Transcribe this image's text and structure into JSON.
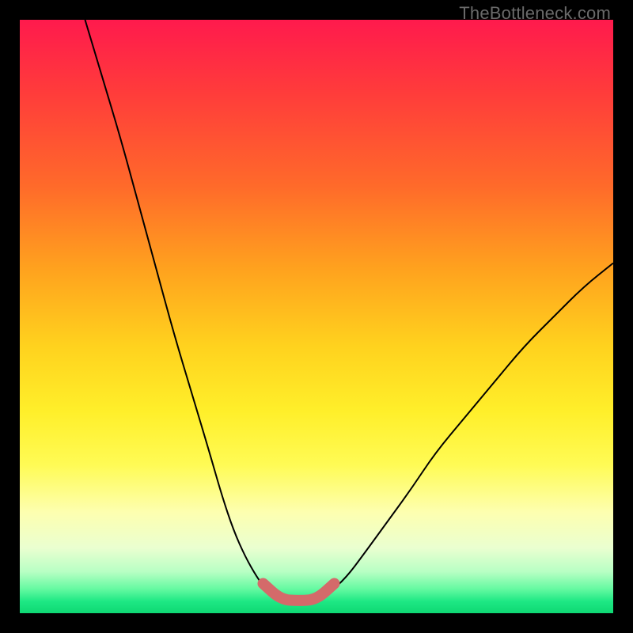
{
  "watermark": "TheBottleneck.com",
  "chart_data": {
    "type": "line",
    "title": "",
    "xlabel": "",
    "ylabel": "",
    "xlim": [
      0,
      100
    ],
    "ylim": [
      0,
      100
    ],
    "grid": false,
    "series": [
      {
        "name": "left-curve",
        "x": [
          11,
          14,
          17,
          20,
          23,
          26,
          29,
          32,
          34,
          36,
          38,
          40,
          41.5,
          43,
          44
        ],
        "y": [
          100,
          90,
          80,
          69,
          58,
          47,
          37,
          27,
          20,
          14,
          9.5,
          6,
          4,
          2.7,
          2.2
        ]
      },
      {
        "name": "right-curve",
        "x": [
          50,
          52,
          55,
          58,
          62,
          66,
          70,
          75,
          80,
          85,
          90,
          95,
          100
        ],
        "y": [
          2.2,
          3.3,
          6,
          10,
          15.5,
          21,
          27,
          33,
          39,
          45,
          50,
          55,
          59
        ]
      },
      {
        "name": "bottom-highlight",
        "x": [
          41,
          44,
          47,
          50,
          53
        ],
        "y": [
          5,
          2.3,
          2.1,
          2.3,
          5
        ]
      }
    ],
    "colors": {
      "gradient_top": "#ff1a4d",
      "gradient_mid": "#ffef2a",
      "gradient_bottom": "#0fd873",
      "curve": "#000000",
      "highlight": "#d46a6a",
      "frame": "#000000"
    }
  }
}
